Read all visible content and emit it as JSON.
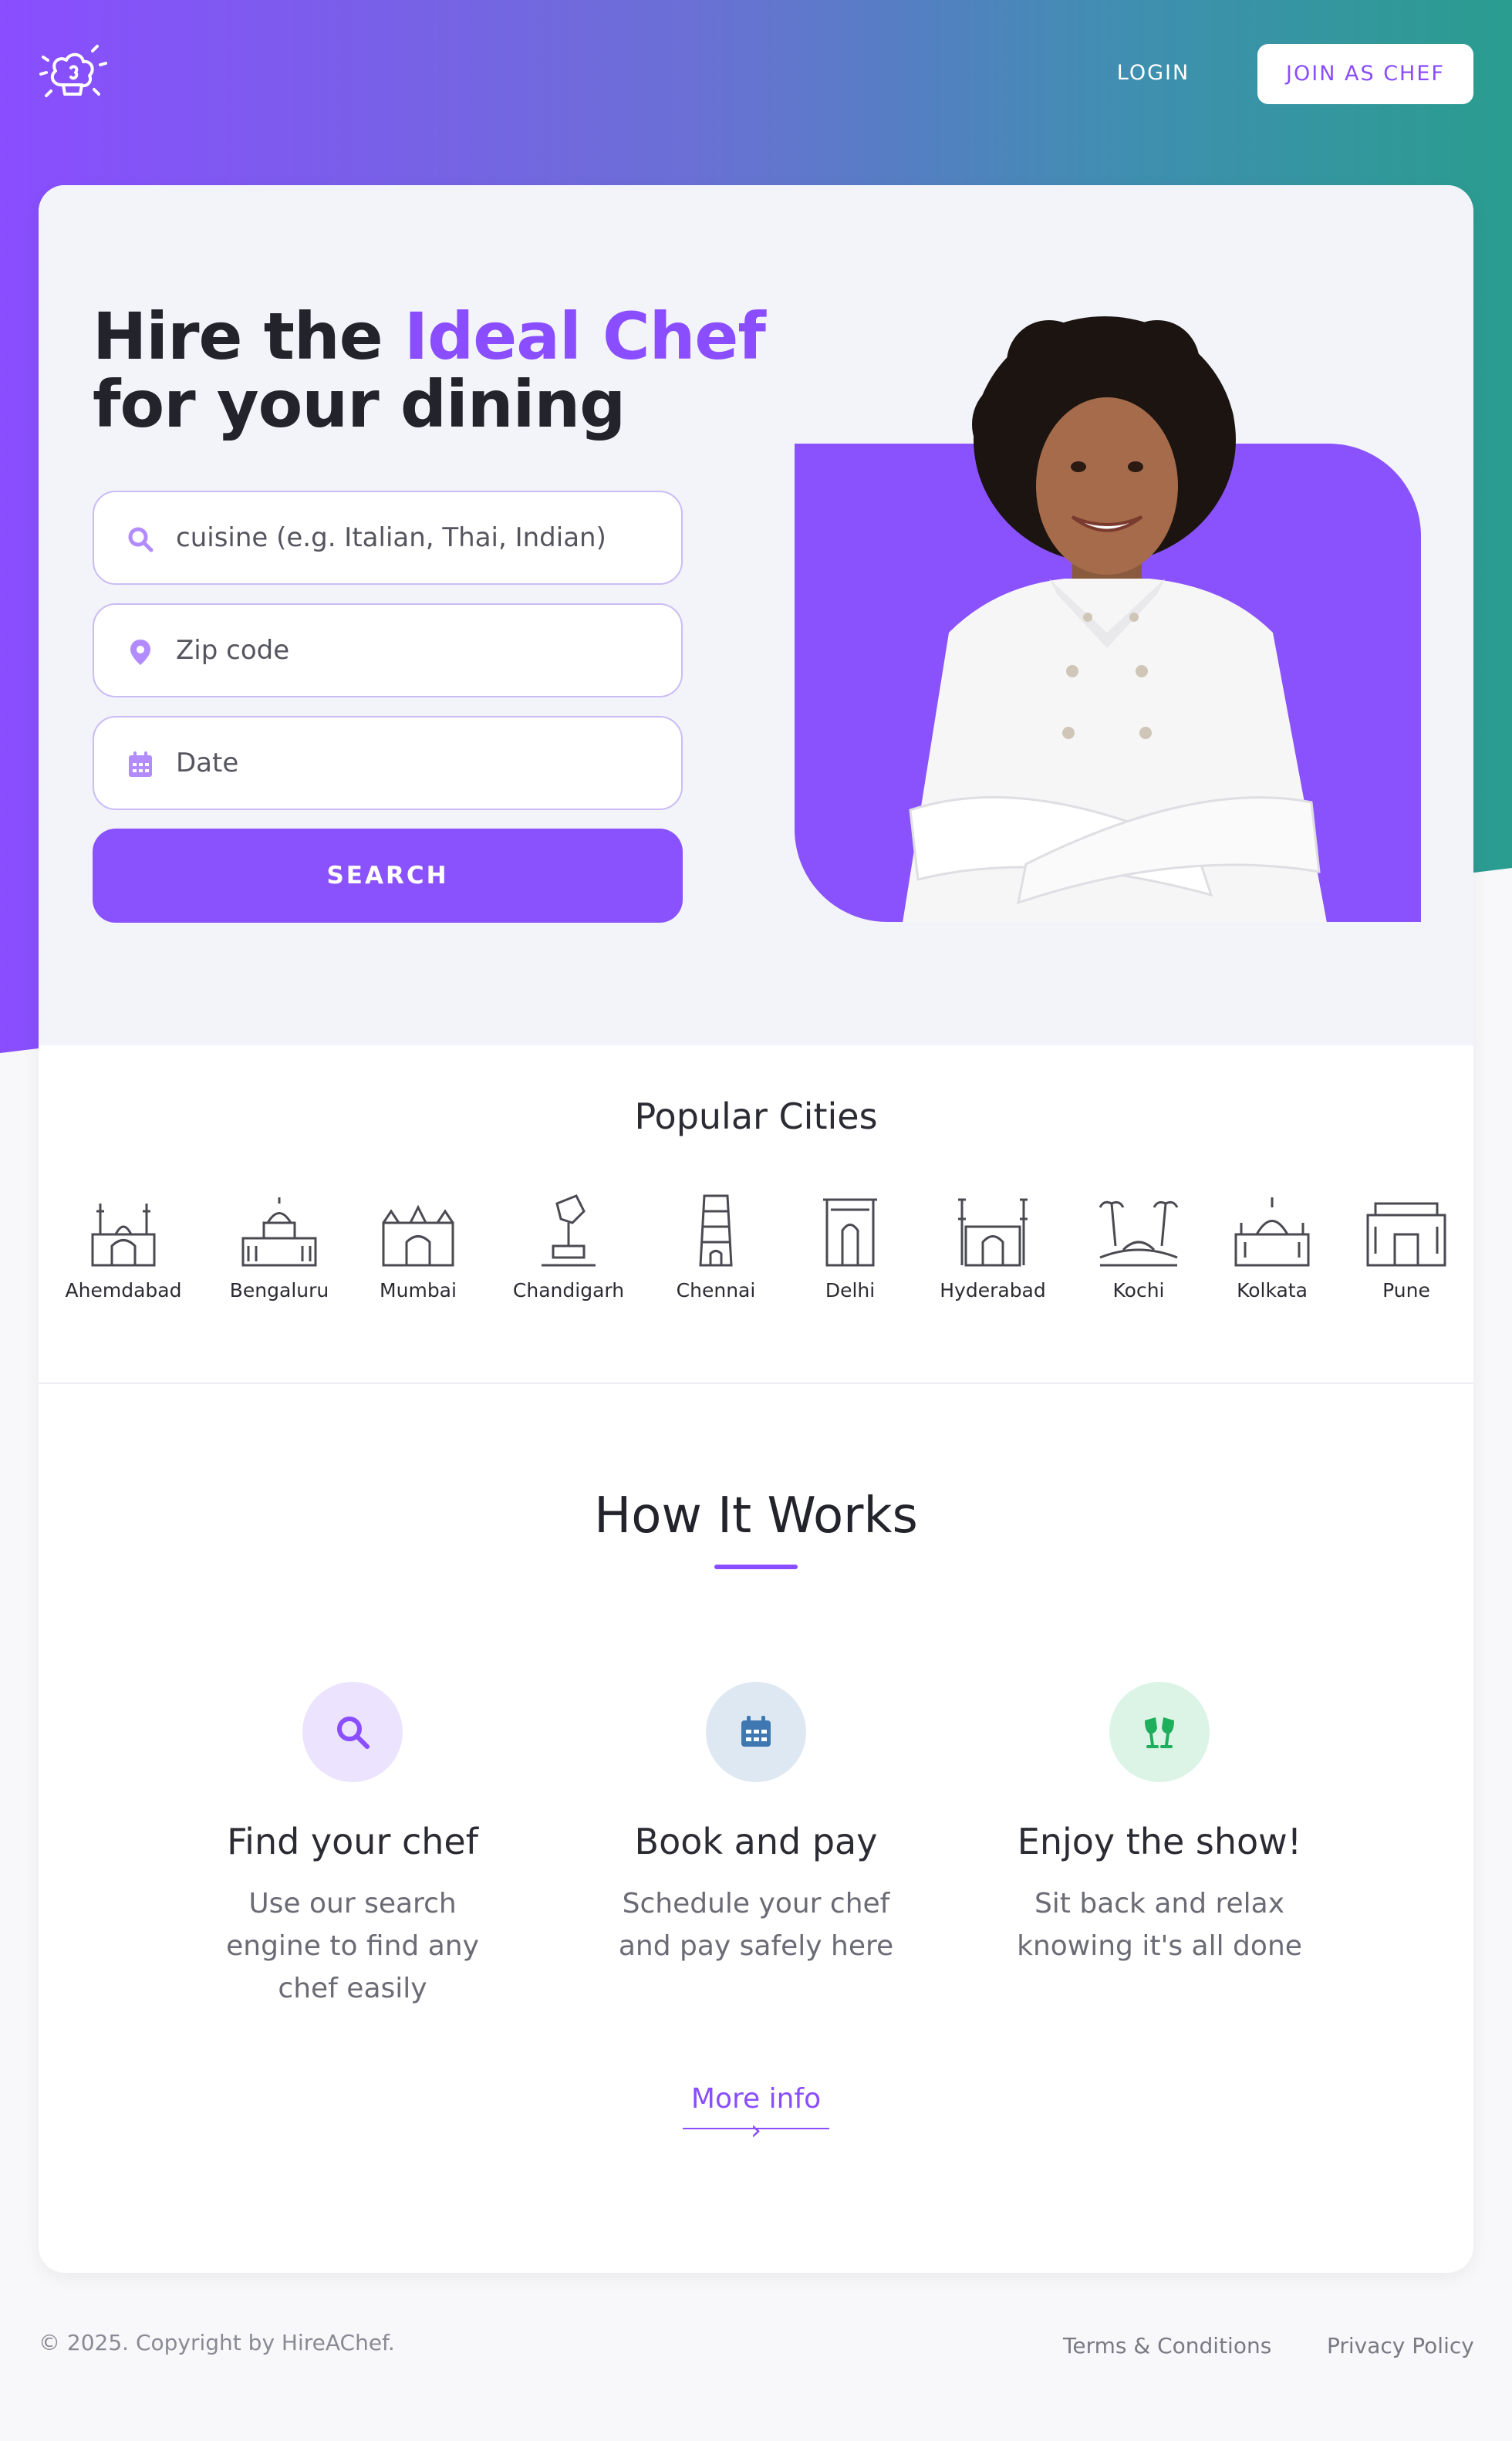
{
  "header": {
    "login_label": "LOGIN",
    "join_label": "JOIN AS CHEF"
  },
  "hero": {
    "headline_part1": "Hire the ",
    "headline_accent": "Ideal Chef",
    "headline_part2": "for your dining",
    "cuisine_placeholder": "cuisine (e.g. Italian, Thai, Indian)",
    "zip_placeholder": "Zip code",
    "date_placeholder": "Date",
    "search_label": "SEARCH"
  },
  "cities": {
    "title": "Popular Cities",
    "items": [
      {
        "label": "Ahemdabad",
        "icon": "ahmedabad-landmark-icon"
      },
      {
        "label": "Bengaluru",
        "icon": "bengaluru-landmark-icon"
      },
      {
        "label": "Mumbai",
        "icon": "mumbai-landmark-icon"
      },
      {
        "label": "Chandigarh",
        "icon": "chandigarh-landmark-icon"
      },
      {
        "label": "Chennai",
        "icon": "chennai-landmark-icon"
      },
      {
        "label": "Delhi",
        "icon": "delhi-landmark-icon"
      },
      {
        "label": "Hyderabad",
        "icon": "hyderabad-landmark-icon"
      },
      {
        "label": "Kochi",
        "icon": "kochi-landmark-icon"
      },
      {
        "label": "Kolkata",
        "icon": "kolkata-landmark-icon"
      },
      {
        "label": "Pune",
        "icon": "pune-landmark-icon"
      }
    ]
  },
  "how": {
    "title": "How It Works",
    "steps": [
      {
        "title": "Find your chef",
        "desc": "Use our search engine to find any chef easily",
        "icon": "search-icon",
        "color": "#8a4dff",
        "bg": "#ece3ff"
      },
      {
        "title": "Book and pay",
        "desc": "Schedule your chef and pay safely here",
        "icon": "calendar-icon",
        "color": "#3f78b0",
        "bg": "#dde8f3"
      },
      {
        "title": "Enjoy the show!",
        "desc": "Sit back and relax knowing it's all done",
        "icon": "glasses-cheers-icon",
        "color": "#1fae5b",
        "bg": "#dcf4e6"
      }
    ],
    "more_label": "More info ›"
  },
  "footer": {
    "copyright": "© 2025. Copyright by HireAChef.",
    "terms_label": "Terms & Conditions",
    "privacy_label": "Privacy Policy"
  },
  "colors": {
    "accent": "#8a4dff",
    "gradient_start": "#8a4dff",
    "gradient_end": "#2a9d8f"
  }
}
